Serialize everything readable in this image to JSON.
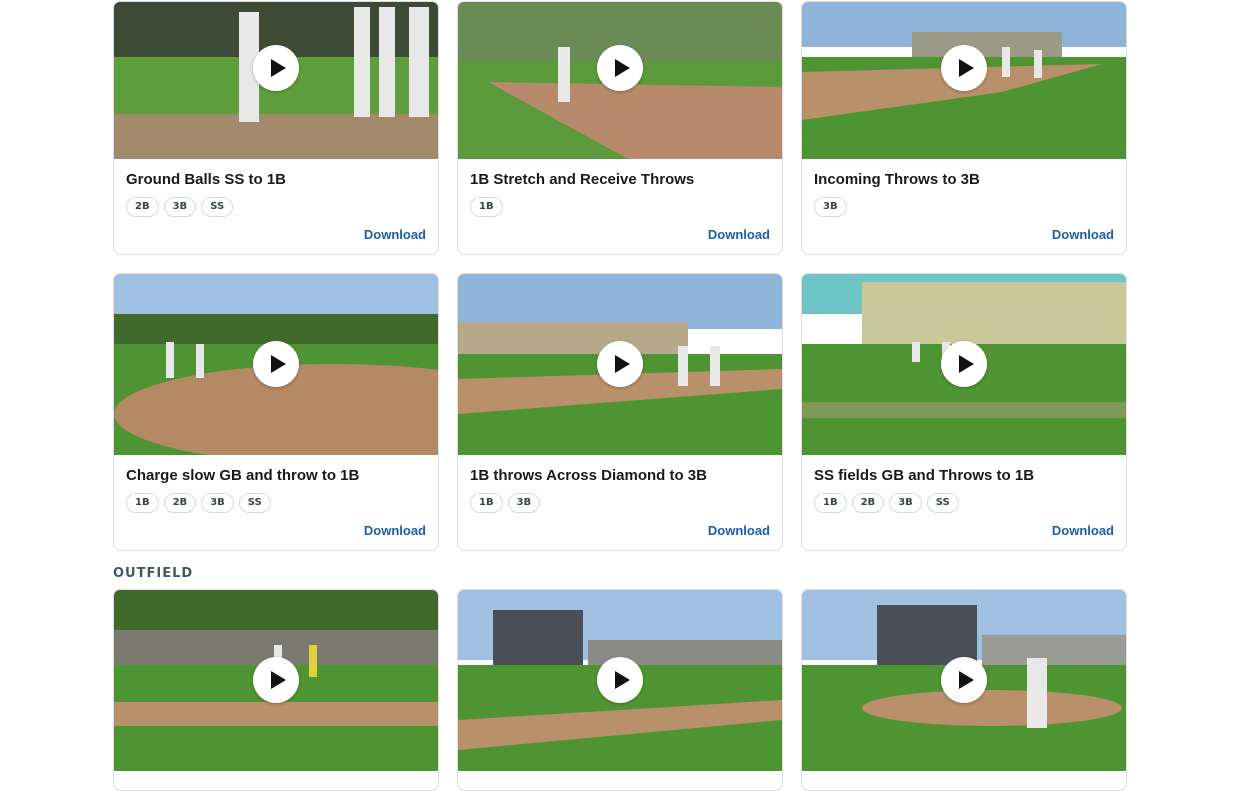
{
  "row1": [
    {
      "title": "Ground Balls SS to 1B",
      "tags": [
        "2B",
        "3B",
        "SS"
      ],
      "download": "Download"
    },
    {
      "title": "1B Stretch and Receive Throws",
      "tags": [
        "1B"
      ],
      "download": "Download"
    },
    {
      "title": "Incoming Throws to 3B",
      "tags": [
        "3B"
      ],
      "download": "Download"
    }
  ],
  "row2": [
    {
      "title": "Charge slow GB and throw to 1B",
      "tags": [
        "1B",
        "2B",
        "3B",
        "SS"
      ],
      "download": "Download"
    },
    {
      "title": "1B throws Across Diamond to 3B",
      "tags": [
        "1B",
        "3B"
      ],
      "download": "Download"
    },
    {
      "title": "SS fields GB and Throws to 1B",
      "tags": [
        "1B",
        "2B",
        "3B",
        "SS"
      ],
      "download": "Download"
    }
  ],
  "outfield": {
    "label": "OUTFIELD"
  },
  "icons": {
    "play": "play-icon"
  }
}
